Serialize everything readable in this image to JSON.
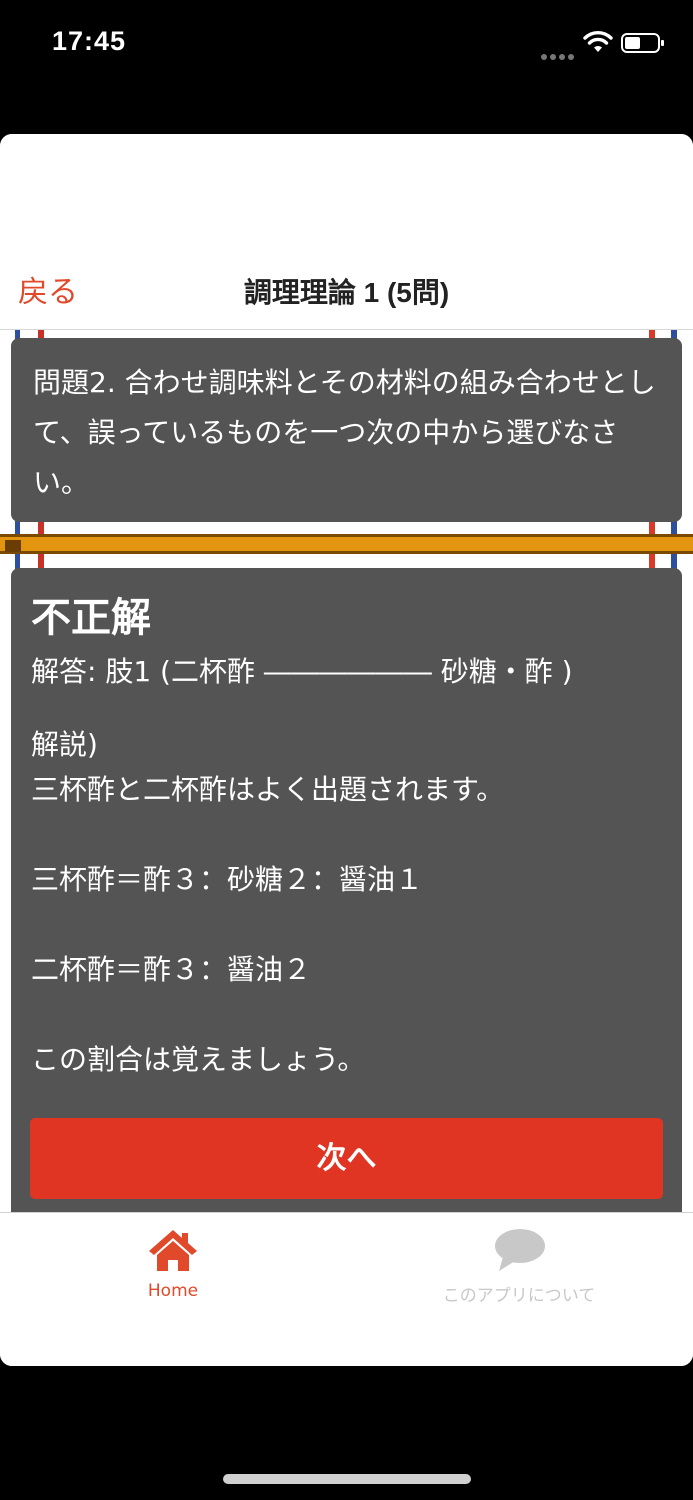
{
  "status_bar": {
    "time": "17:45"
  },
  "nav": {
    "back_label": "戻る",
    "title": "調理理論 1 (5問)"
  },
  "question": {
    "text": "問題2. 合わせ調味料とその材料の組み合わせとして、誤っているものを一つ次の中から選びなさい。"
  },
  "answer": {
    "result": "不正解",
    "answer_line": "解答: 肢1 (二杯酢 ―――――― 砂糖・酢 )",
    "explanation_lines": [
      "解説)",
      "三杯酢と二杯酢はよく出題されます。",
      "",
      "三杯酢＝酢３：砂糖２：醤油１",
      "",
      "二杯酢＝酢３：醤油２",
      "",
      "この割合は覚えましょう。"
    ]
  },
  "next_button": {
    "label": "次へ"
  },
  "tabs": [
    {
      "label": "Home",
      "icon": "home-icon",
      "active": true
    },
    {
      "label": "このアプリについて",
      "icon": "speech-bubble-icon",
      "active": false
    }
  ],
  "colors": {
    "accent": "#e0492a",
    "card": "#545454",
    "button": "#e03523",
    "divider": "#e39510"
  }
}
